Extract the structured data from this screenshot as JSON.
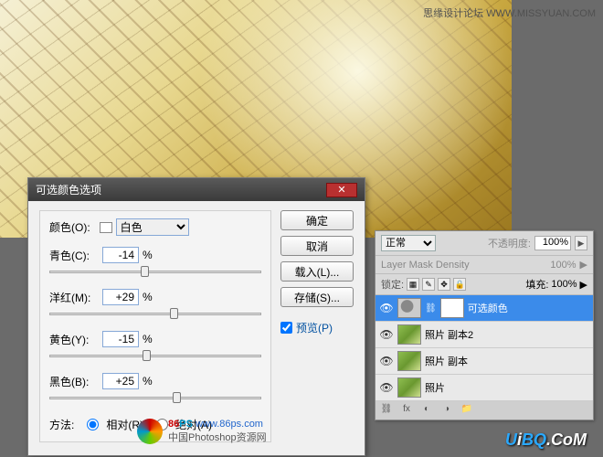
{
  "caption": "思缘设计论坛  WWW.MISSYUAN.COM",
  "dialog": {
    "title": "可选颜色选项",
    "color_label": "颜色(O):",
    "color_value": "白色",
    "sliders": [
      {
        "label": "青色(C):",
        "value": "-14",
        "pct": "%",
        "pos": 43
      },
      {
        "label": "洋红(M):",
        "value": "+29",
        "pct": "%",
        "pos": 57
      },
      {
        "label": "黄色(Y):",
        "value": "-15",
        "pct": "%",
        "pos": 44
      },
      {
        "label": "黑色(B):",
        "value": "+25",
        "pct": "%",
        "pos": 58
      }
    ],
    "method_label": "方法:",
    "method_rel": "相对(R)",
    "method_abs": "绝对(A)",
    "buttons": {
      "ok": "确定",
      "cancel": "取消",
      "load": "载入(L)...",
      "save": "存储(S)..."
    },
    "preview": "预览(P)"
  },
  "layers": {
    "blend_mode": "正常",
    "opacity_label": "不透明度:",
    "opacity_value": "100%",
    "density_label": "Layer Mask Density",
    "density_value": "100%",
    "lock_label": "锁定:",
    "fill_label": "填充:",
    "fill_value": "100%",
    "items": [
      {
        "name": "可选颜色",
        "selected": true,
        "adj": true
      },
      {
        "name": "照片 副本2",
        "selected": false,
        "adj": false
      },
      {
        "name": "照片 副本",
        "selected": false,
        "adj": false
      },
      {
        "name": "照片",
        "selected": false,
        "adj": false
      }
    ]
  },
  "watermarks": {
    "site86": "www.86ps.com",
    "site86_sub": "中国Photoshop资源网",
    "brand86": "86",
    "brand86ps": "PS",
    "uibq": "UiBQ.CoM"
  }
}
